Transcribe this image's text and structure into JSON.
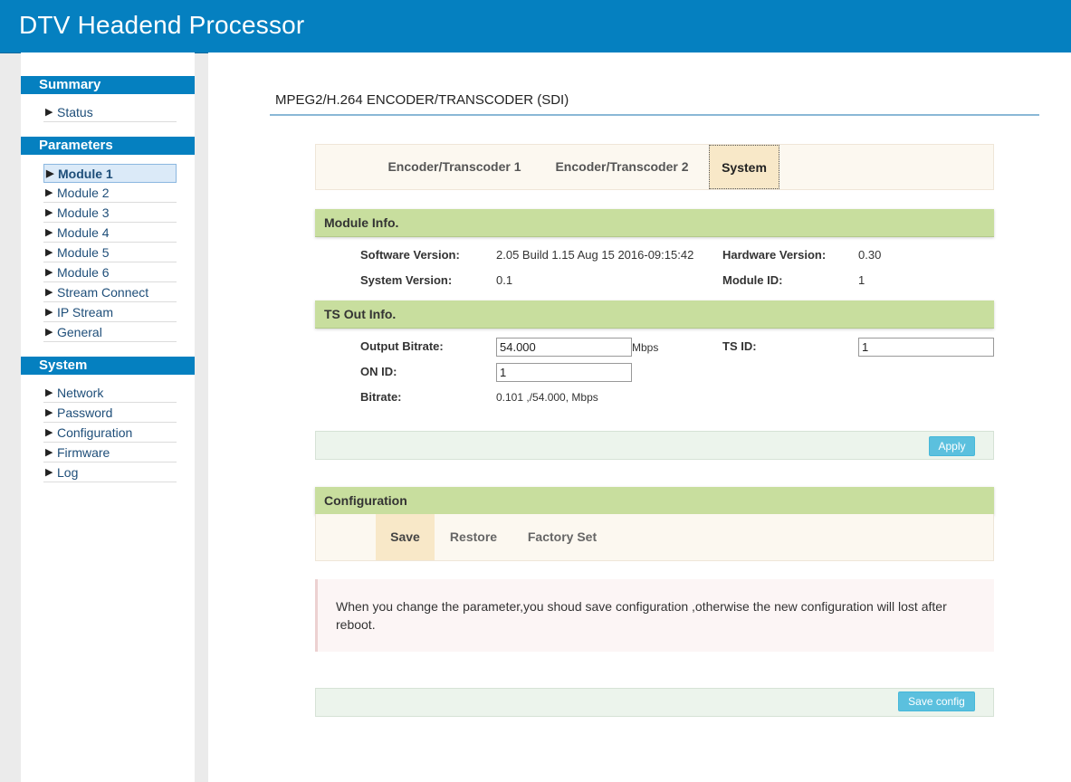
{
  "app": {
    "title": "DTV Headend Processor"
  },
  "sidebar": {
    "summary": {
      "heading": "Summary",
      "items": [
        "Status"
      ]
    },
    "parameters": {
      "heading": "Parameters",
      "items": [
        "Module 1",
        "Module 2",
        "Module 3",
        "Module 4",
        "Module 5",
        "Module 6",
        "Stream Connect",
        "IP Stream",
        "General"
      ],
      "active": "Module 1"
    },
    "system": {
      "heading": "System",
      "items": [
        "Network",
        "Password",
        "Configuration",
        "Firmware",
        "Log"
      ]
    }
  },
  "main": {
    "page_title": "MPEG2/H.264 ENCODER/TRANSCODER (SDI)",
    "tabs": [
      "Encoder/Transcoder 1",
      "Encoder/Transcoder 2",
      "System"
    ],
    "active_tab": "System",
    "module_info": {
      "heading": "Module Info.",
      "software_version_label": "Software Version:",
      "software_version": "2.05 Build 1.15 Aug 15 2016-09:15:42",
      "hardware_version_label": "Hardware Version:",
      "hardware_version": "0.30",
      "system_version_label": "System Version:",
      "system_version": "0.1",
      "module_id_label": "Module ID:",
      "module_id": "1"
    },
    "ts_out_info": {
      "heading": "TS Out Info.",
      "output_bitrate_label": "Output Bitrate:",
      "output_bitrate": "54.000",
      "output_bitrate_unit": "Mbps",
      "ts_id_label": "TS ID:",
      "ts_id": "1",
      "on_id_label": "ON ID:",
      "on_id": "1",
      "bitrate_label": "Bitrate:",
      "bitrate": "0.101 ,/54.000, Mbps"
    },
    "apply_label": "Apply",
    "configuration": {
      "heading": "Configuration",
      "tabs": [
        "Save",
        "Restore",
        "Factory Set"
      ],
      "active_tab": "Save",
      "notice": "When you change the parameter,you shoud save configuration ,otherwise the new configuration will lost after reboot.",
      "save_config_label": "Save config"
    }
  },
  "colors": {
    "header": "#0580c0",
    "panel_head": "#c8de9e",
    "button": "#5bc0de",
    "active_tab": "#f8e8c8"
  }
}
